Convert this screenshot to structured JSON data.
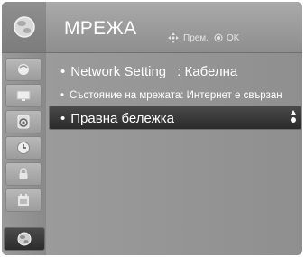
{
  "header": {
    "title": "МРЕЖА",
    "hint_move": "Прем.",
    "hint_ok": "OK"
  },
  "menu": {
    "items": [
      {
        "label": "Network Setting",
        "value": ": Кабелна"
      },
      {
        "label": "Състояние на мрежата: Интернет е свързан",
        "value": ""
      },
      {
        "label": "Правна бележка",
        "value": ""
      }
    ],
    "bullet": "•"
  },
  "sidebar": {
    "icons": [
      "picture-icon",
      "screen-icon",
      "audio-icon",
      "clock-icon",
      "lock-icon",
      "options-icon",
      "network-icon"
    ]
  },
  "colors": {
    "panel": "#8e8e8e",
    "selected": "#2c2c2c",
    "text": "#ffffff"
  }
}
